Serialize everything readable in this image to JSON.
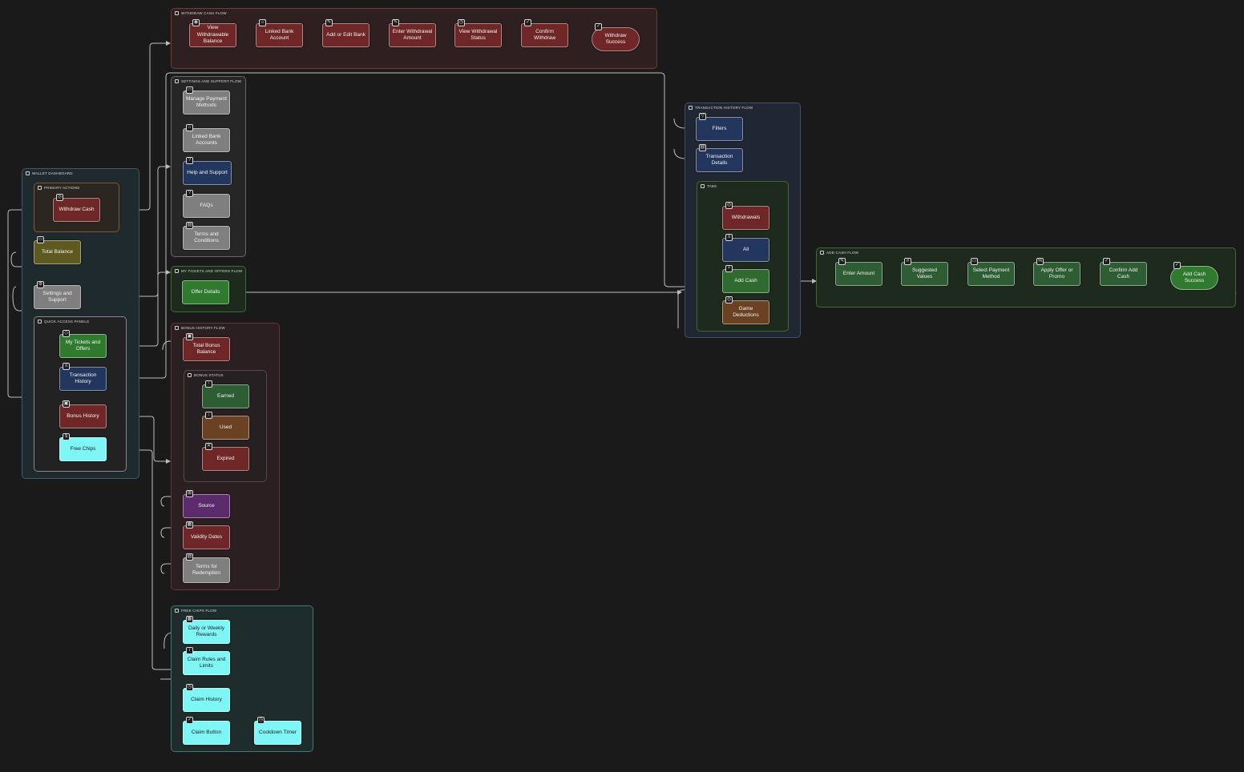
{
  "colors": {
    "background": "#1a1a1a",
    "red_node": "#6e2626",
    "blue_node": "#23375e",
    "green_node": "#2f6b30",
    "gray_node": "#7f7f7f",
    "olive_node": "#5e5a1f",
    "cyan_node": "#7ff6f6",
    "brown_node": "#6a4223",
    "purple_node": "#5c2b6b",
    "edge": "#bdbdbd"
  },
  "groups": {
    "wallet_dashboard": "WALLET DASHBOARD",
    "primary_actions": "PRIMARY ACTIONS",
    "quick_access": "QUICK ACCESS PANELS",
    "withdraw_flow": "WITHDRAW CASH FLOW",
    "settings_flow": "SETTINGS AND SUPPORT FLOW",
    "tickets_flow": "MY TICKETS AND OFFERS FLOW",
    "bonus_flow": "BONUS HISTORY FLOW",
    "bonus_status": "BONUS STATUS",
    "free_chips_flow": "FREE CHIPS FLOW",
    "transaction_flow": "TRANSACTION HISTORY FLOW",
    "tabs": "TABS",
    "add_cash_flow": "ADD CASH FLOW"
  },
  "nodes": {
    "withdraw_cash": "Withdraw Cash",
    "total_balance": "Total Balance",
    "settings_support": "Settings and Support",
    "my_tickets": "My Tickets and Offers",
    "transaction_history": "Transaction History",
    "bonus_history": "Bonus History",
    "free_chips": "Free Chips",
    "view_withdrawable": "View Withdrawable Balance",
    "linked_bank_account": "Linked Bank Account",
    "add_edit_bank": "Add or Edit Bank",
    "enter_withdrawal": "Enter Withdrawal Amount",
    "view_withdrawal_status": "View Withdrawal Status",
    "confirm_withdraw": "Confirm Withdraw",
    "withdraw_success": "Withdraw Success",
    "manage_payment": "Manage Payment Methods",
    "linked_bank_accounts": "Linked Bank Accounts",
    "help_support": "Help and Support",
    "faqs": "FAQs",
    "terms_conditions": "Terms and Conditions",
    "offer_details": "Offer Details",
    "total_bonus_balance": "Total Bonus Balance",
    "earned": "Earned",
    "used": "Used",
    "expired": "Expired",
    "source": "Source",
    "validity_dates": "Validity Dates",
    "terms_redemption": "Terms for Redemption",
    "daily_weekly": "Daily or Weekly Rewards",
    "claim_rules": "Claim Rules and Limits",
    "claim_history": "Claim History",
    "claim_button": "Claim Button",
    "cooldown_timer": "Cooldown Timer",
    "filters": "Filters",
    "transaction_details": "Transaction Details",
    "withdrawals": "Withdrawals",
    "all": "All",
    "add_cash": "Add Cash",
    "game_deductions": "Game Deductions",
    "enter_amount": "Enter Amount",
    "suggested_values": "Suggested Values",
    "select_payment": "Select Payment Method",
    "apply_offer": "Apply Offer or Promo",
    "confirm_add_cash": "Confirm Add Cash",
    "add_cash_success": "Add Cash Success"
  },
  "icons": {
    "withdraw_cash": "target-icon",
    "total_balance": "wallet-icon",
    "settings_support": "gear-icon",
    "my_tickets": "ticket-icon",
    "transaction_history": "list-icon",
    "bonus_history": "gift-icon",
    "free_chips": "coin-icon"
  }
}
